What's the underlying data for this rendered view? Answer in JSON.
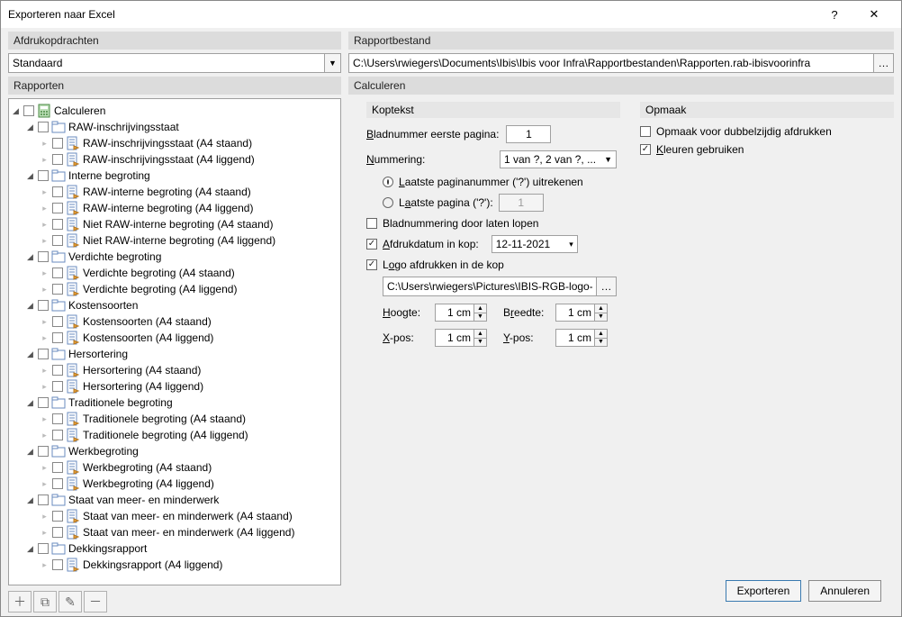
{
  "window": {
    "title": "Exporteren naar Excel"
  },
  "left": {
    "afdruk_hdr": "Afdrukopdrachten",
    "afdruk_value": "Standaard",
    "rapporten_hdr": "Rapporten",
    "tree_root": "Calculeren",
    "groups": [
      {
        "label": "RAW-inschrijvingsstaat",
        "items": [
          "RAW-inschrijvingsstaat (A4 staand)",
          "RAW-inschrijvingsstaat (A4 liggend)"
        ]
      },
      {
        "label": "Interne begroting",
        "items": [
          "RAW-interne begroting (A4 staand)",
          "RAW-interne begroting (A4 liggend)",
          "Niet RAW-interne begroting (A4 staand)",
          "Niet RAW-interne begroting (A4 liggend)"
        ]
      },
      {
        "label": "Verdichte begroting",
        "items": [
          "Verdichte begroting (A4 staand)",
          "Verdichte begroting (A4 liggend)"
        ]
      },
      {
        "label": "Kostensoorten",
        "items": [
          "Kostensoorten (A4 staand)",
          "Kostensoorten (A4 liggend)"
        ]
      },
      {
        "label": "Hersortering",
        "items": [
          "Hersortering (A4 staand)",
          "Hersortering (A4 liggend)"
        ]
      },
      {
        "label": "Traditionele begroting",
        "items": [
          "Traditionele begroting (A4 staand)",
          "Traditionele begroting (A4 liggend)"
        ]
      },
      {
        "label": "Werkbegroting",
        "items": [
          "Werkbegroting (A4 staand)",
          "Werkbegroting (A4 liggend)"
        ]
      },
      {
        "label": "Staat van meer- en minderwerk",
        "items": [
          "Staat van meer- en minderwerk (A4 staand)",
          "Staat van meer- en minderwerk (A4 liggend)"
        ]
      },
      {
        "label": "Dekkingsrapport",
        "items": [
          "Dekkingsrapport (A4 liggend)"
        ]
      }
    ]
  },
  "right": {
    "rapportbestand_hdr": "Rapportbestand",
    "rapportbestand_value": "C:\\Users\\rwiegers\\Documents\\Ibis\\Ibis voor Infra\\Rapportbestanden\\Rapporten.rab-ibisvoorinfra",
    "calculeren_hdr": "Calculeren",
    "koptekst_hdr": "Koptekst",
    "opmaak_hdr": "Opmaak",
    "bladnummer_label": "Bladnummer eerste pagina:",
    "bladnummer_value": "1",
    "nummering_label": "Nummering:",
    "nummering_value": "1 van ?, 2 van ?, ...",
    "radio_calc": "Laatste paginanummer ('?') uitrekenen",
    "radio_fixed": "Laatste pagina ('?'):",
    "radio_fixed_value": "1",
    "cb_doorlopen": "Bladnummering door laten lopen",
    "cb_afdrukdatum": "Afdrukdatum in kop:",
    "afdrukdatum_value": "12-11-2021",
    "cb_logo": "Logo afdrukken in de kop",
    "logo_path": "C:\\Users\\rwiegers\\Pictures\\IBIS-RGB-logo-only",
    "hoogte_lbl": "Hoogte:",
    "breedte_lbl": "Breedte:",
    "xpos_lbl": "X-pos:",
    "ypos_lbl": "Y-pos:",
    "dim_value": "1 cm",
    "cb_dubbel": "Opmaak voor dubbelzijdig afdrukken",
    "cb_kleuren": "Kleuren gebruiken"
  },
  "footer": {
    "export": "Exporteren",
    "cancel": "Annuleren"
  }
}
